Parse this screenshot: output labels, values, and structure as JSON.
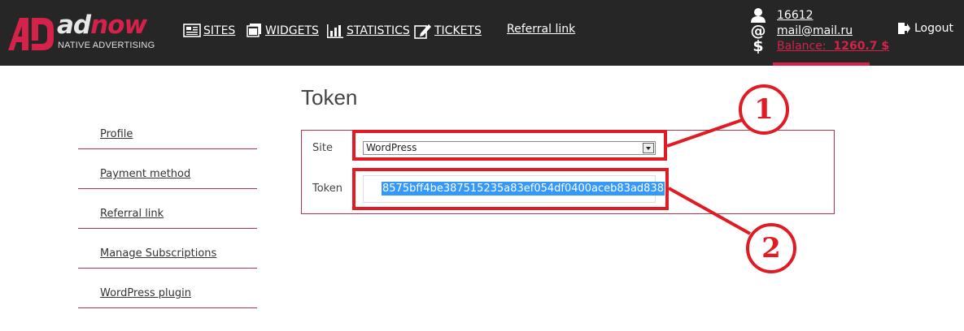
{
  "brand": {
    "logo_ad": "ad",
    "logo_now": "now",
    "tagline": "NATIVE ADVERTISING"
  },
  "nav": {
    "items": [
      {
        "label": "SITES",
        "icon": "sites-icon"
      },
      {
        "label": "WIDGETS",
        "icon": "widgets-icon"
      },
      {
        "label": "STATISTICS",
        "icon": "statistics-icon"
      },
      {
        "label": "TICKETS",
        "icon": "tickets-icon"
      }
    ],
    "referral_link": "Referral link"
  },
  "account": {
    "user_id": "16612",
    "email": "mail@mail.ru",
    "balance_label": "Balance:",
    "balance_value": "1260.7 $"
  },
  "logout_label": "Logout",
  "sidebar": {
    "items": [
      {
        "label": "Profile"
      },
      {
        "label": "Payment method"
      },
      {
        "label": "Referral link"
      },
      {
        "label": "Manage Subscriptions"
      },
      {
        "label": "WordPress plugin"
      }
    ]
  },
  "main": {
    "title": "Token",
    "site_label": "Site",
    "site_value": "WordPress",
    "token_label": "Token",
    "token_value": "8575bff4be387515235a83ef054df0400aceb83ad838"
  },
  "annotations": {
    "first": "1",
    "second": "2",
    "color": "#e01b24"
  },
  "colors": {
    "header_bg": "#262626",
    "accent": "#d4224a"
  }
}
